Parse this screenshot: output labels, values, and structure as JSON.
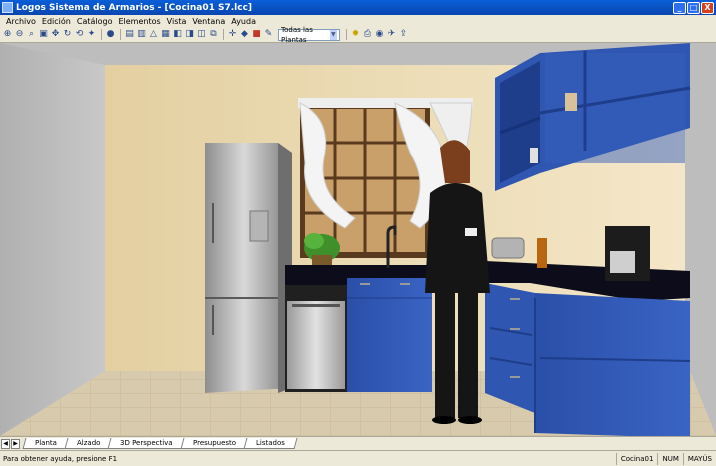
{
  "window": {
    "title": "Logos Sistema de Armarios - [Cocina01 S7.lcc]",
    "minimize": "_",
    "maximize": "□",
    "close": "X"
  },
  "menu": [
    "Archivo",
    "Edición",
    "Catálogo",
    "Elementos",
    "Vista",
    "Ventana",
    "Ayuda"
  ],
  "toolbar": {
    "view_select": "Todas las Plantas"
  },
  "tabs": [
    "Planta",
    "Alzado",
    "3D Perspectiva",
    "Presupuesto",
    "Listados"
  ],
  "statusbar": {
    "left": "Para obtener ayuda, presione F1",
    "cells": [
      "Cocina01",
      "NUM",
      "MAYÚS"
    ]
  },
  "colors": {
    "cabinet_blue": "#2f56b0",
    "countertop": "#0c0c1a",
    "wall_back": "#e4d3a8",
    "floor": "#d7c9aa"
  }
}
